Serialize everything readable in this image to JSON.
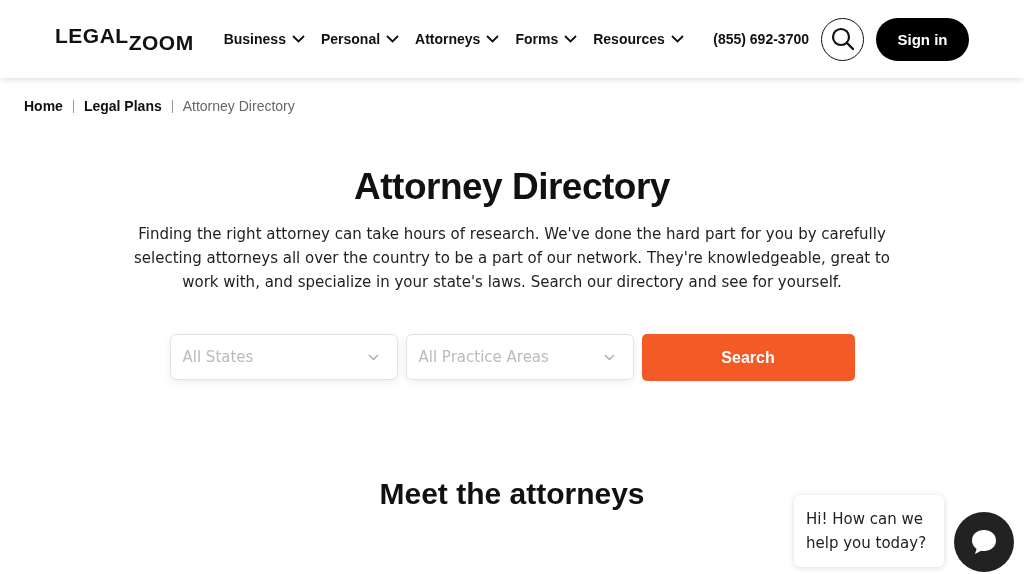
{
  "header": {
    "logo": [
      "LEGAL",
      "ZOOM"
    ],
    "nav": [
      {
        "label": "Business"
      },
      {
        "label": "Personal"
      },
      {
        "label": "Attorneys"
      },
      {
        "label": "Forms"
      },
      {
        "label": "Resources"
      }
    ],
    "phone": "(855) 692-3700",
    "sign_in": "Sign in"
  },
  "breadcrumb": [
    {
      "label": "Home",
      "current": false
    },
    {
      "label": "Legal Plans",
      "current": false
    },
    {
      "label": "Attorney Directory",
      "current": true
    }
  ],
  "title": "Attorney Directory",
  "intro": "Finding the right attorney can take hours of research. We've done the hard part for you by carefully selecting attorneys all over the country to be a part of our network. They're knowledgeable, great to work with, and specialize in your state's laws. Search our directory and see for yourself.",
  "search": {
    "selects": [
      {
        "placeholder": "All States"
      },
      {
        "placeholder": "All Practice Areas"
      }
    ],
    "button": "Search"
  },
  "section_title": "Meet the attorneys",
  "chat": {
    "message": "Hi! How can we help you today?"
  }
}
